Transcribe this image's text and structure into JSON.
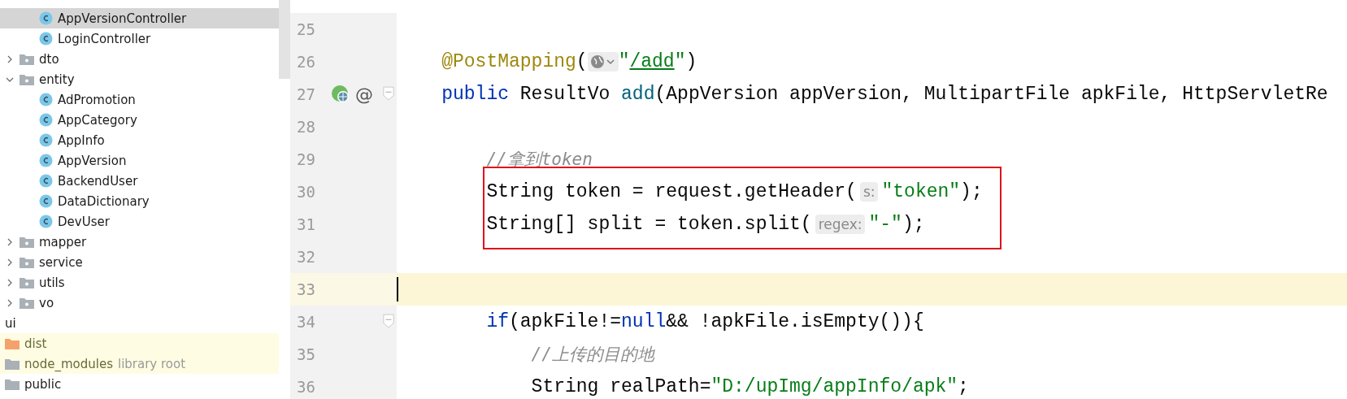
{
  "project_tree": {
    "items": [
      {
        "kind": "class",
        "label": "AppVersionController",
        "selected": true
      },
      {
        "kind": "class",
        "label": "LoginController",
        "selected": false
      },
      {
        "kind": "package",
        "label": "dto",
        "expanded": false,
        "selected": false
      },
      {
        "kind": "package",
        "label": "entity",
        "expanded": true,
        "selected": false,
        "children": [
          {
            "kind": "class",
            "label": "AdPromotion",
            "selected": false
          },
          {
            "kind": "class",
            "label": "AppCategory",
            "selected": false
          },
          {
            "kind": "class",
            "label": "AppInfo",
            "selected": false
          },
          {
            "kind": "class",
            "label": "AppVersion",
            "selected": false
          },
          {
            "kind": "class",
            "label": "BackendUser",
            "selected": false
          },
          {
            "kind": "class",
            "label": "DataDictionary",
            "selected": false
          },
          {
            "kind": "class",
            "label": "DevUser",
            "selected": false
          }
        ]
      },
      {
        "kind": "package",
        "label": "mapper",
        "expanded": false,
        "selected": false
      },
      {
        "kind": "package",
        "label": "service",
        "expanded": false,
        "selected": false
      },
      {
        "kind": "package",
        "label": "utils",
        "expanded": false,
        "selected": false
      },
      {
        "kind": "package",
        "label": "vo",
        "expanded": false,
        "selected": false
      },
      {
        "kind": "module",
        "label": "ui",
        "selected": false
      },
      {
        "kind": "excluded_folder",
        "label": "dist",
        "selected": false
      },
      {
        "kind": "library_folder",
        "label": "node_modules",
        "note": "library root",
        "selected": false
      },
      {
        "kind": "folder",
        "label": "public",
        "selected": false
      }
    ]
  },
  "editor": {
    "lines": [
      {
        "number": "25",
        "kind": "member",
        "current": false,
        "boxed": false,
        "fold": false
      },
      {
        "number": "26",
        "kind": "member",
        "current": false,
        "boxed": false,
        "fold": false,
        "tokens": [
          {
            "kind": "annotation",
            "text": "@PostMapping"
          },
          {
            "kind": "plain",
            "text": "("
          },
          {
            "kind": "globe_hint"
          },
          {
            "kind": "string",
            "text": "\""
          },
          {
            "kind": "url",
            "text": "/add"
          },
          {
            "kind": "string",
            "text": "\""
          },
          {
            "kind": "plain",
            "text": ")"
          }
        ]
      },
      {
        "number": "27",
        "kind": "member",
        "current": false,
        "boxed": false,
        "fold": true,
        "gutter": {
          "kind": "endpoint",
          "mark": "@"
        },
        "tokens": [
          {
            "kind": "keyword",
            "text": "public"
          },
          {
            "kind": "plain",
            "text": " ResultVo "
          },
          {
            "kind": "method",
            "text": "add"
          },
          {
            "kind": "plain",
            "text": "(AppVersion appVersion, MultipartFile apkFile, HttpServletRe"
          }
        ]
      },
      {
        "number": "28",
        "kind": "body",
        "current": false,
        "boxed": false,
        "fold": false
      },
      {
        "number": "29",
        "kind": "body",
        "current": false,
        "boxed": false,
        "fold": false,
        "tokens": [
          {
            "kind": "comment",
            "text": "//拿到token"
          }
        ]
      },
      {
        "number": "30",
        "kind": "body",
        "current": false,
        "boxed": true,
        "fold": false,
        "tokens": [
          {
            "kind": "plain",
            "text": "String token = request.getHeader("
          },
          {
            "kind": "hint",
            "text": "s:"
          },
          {
            "kind": "string",
            "text": "\"token\""
          },
          {
            "kind": "plain",
            "text": ");"
          }
        ]
      },
      {
        "number": "31",
        "kind": "body",
        "current": false,
        "boxed": true,
        "fold": false,
        "tokens": [
          {
            "kind": "plain",
            "text": "String[] split = token.split("
          },
          {
            "kind": "hint",
            "text": "regex:"
          },
          {
            "kind": "string",
            "text": "\"-\""
          },
          {
            "kind": "plain",
            "text": ");"
          }
        ]
      },
      {
        "number": "32",
        "kind": "body",
        "current": false,
        "boxed": false,
        "fold": false
      },
      {
        "number": "33",
        "kind": "body",
        "current": true,
        "boxed": false,
        "fold": false
      },
      {
        "number": "34",
        "kind": "body",
        "current": false,
        "boxed": false,
        "fold": true,
        "tokens": [
          {
            "kind": "keyword",
            "text": "if"
          },
          {
            "kind": "plain",
            "text": "(apkFile!="
          },
          {
            "kind": "keyword",
            "text": "null"
          },
          {
            "kind": "plain",
            "text": "&& !apkFile.isEmpty()){"
          }
        ]
      },
      {
        "number": "35",
        "kind": "block",
        "current": false,
        "boxed": false,
        "fold": false,
        "tokens": [
          {
            "kind": "comment",
            "text": "//上传的目的地"
          }
        ]
      },
      {
        "number": "36",
        "kind": "block",
        "current": false,
        "boxed": false,
        "fold": false,
        "tokens": [
          {
            "kind": "plain",
            "text": "String realPath="
          },
          {
            "kind": "string",
            "text": "\"D:/upImg/appInfo/apk\""
          },
          {
            "kind": "plain",
            "text": ";"
          }
        ]
      }
    ]
  }
}
